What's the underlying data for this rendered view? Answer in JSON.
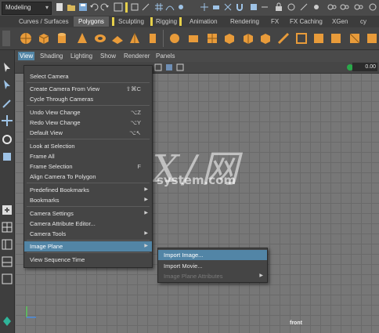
{
  "status_line": {
    "mode": "Modeling"
  },
  "shelf_tabs": [
    {
      "label": "Curves / Surfaces"
    },
    {
      "label": "Polygons"
    },
    {
      "label": "Sculpting"
    },
    {
      "label": "Rigging"
    },
    {
      "label": "Animation"
    },
    {
      "label": "Rendering"
    },
    {
      "label": "FX"
    },
    {
      "label": "FX Caching"
    },
    {
      "label": "XGen"
    },
    {
      "label": "cy"
    }
  ],
  "panel_menus": [
    "View",
    "Shading",
    "Lighting",
    "Show",
    "Renderer",
    "Panels"
  ],
  "panel_toolbar": {
    "value": "0.00"
  },
  "view_menu": {
    "items": [
      {
        "label": "Select Camera"
      },
      {
        "label": "Create Camera From View",
        "shortcut": "⇧⌘C"
      },
      {
        "label": "Cycle Through Cameras"
      },
      {
        "label": "Undo View Change",
        "shortcut": "⌥Z"
      },
      {
        "label": "Redo View Change",
        "shortcut": "⌥Y"
      },
      {
        "label": "Default View",
        "shortcut": "⌥↖"
      },
      {
        "label": "Look at Selection"
      },
      {
        "label": "Frame All"
      },
      {
        "label": "Frame Selection",
        "shortcut": "F"
      },
      {
        "label": "Align Camera To Polygon"
      },
      {
        "label": "Predefined Bookmarks"
      },
      {
        "label": "Bookmarks"
      },
      {
        "label": "Camera Settings"
      },
      {
        "label": "Camera Attribute Editor..."
      },
      {
        "label": "Camera Tools"
      },
      {
        "label": "Image Plane"
      },
      {
        "label": "View Sequence Time"
      }
    ]
  },
  "image_plane_submenu": {
    "items": [
      {
        "label": "Import Image..."
      },
      {
        "label": "Import Movie..."
      },
      {
        "label": "Image Plane Attributes"
      }
    ]
  },
  "viewport": {
    "camera_label": "front"
  },
  "watermark": {
    "big": "GX/网",
    "small": "system.com"
  },
  "colors": {
    "highlight": "#5285a6",
    "accent": "#e5cf4a",
    "shelf_icon": "#e89b3a"
  }
}
